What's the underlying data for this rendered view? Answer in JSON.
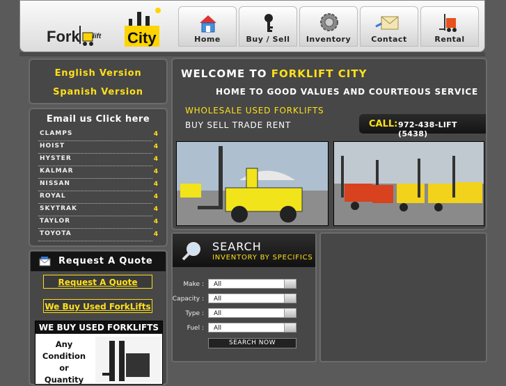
{
  "header": {
    "logo": {
      "word1": "Fork",
      "word2": "lift",
      "word3": "City"
    },
    "nav": [
      {
        "label": "Home",
        "icon": "house-icon"
      },
      {
        "label": "Buy / Sell",
        "icon": "key-icon"
      },
      {
        "label": "Inventory",
        "icon": "gear-icon"
      },
      {
        "label": "Contact",
        "icon": "envelope-icon"
      },
      {
        "label": "Rental",
        "icon": "forklift-icon"
      }
    ]
  },
  "sidebar": {
    "languages": [
      "English Version",
      "Spanish Version"
    ],
    "email": {
      "label": "Email us",
      "link": "Click here"
    },
    "brands": [
      "CLAMPS",
      "HOIST",
      "HYSTER",
      "KALMAR",
      "NISSAN",
      "ROYAL",
      "SKYTRAK",
      "TAYLOR",
      "TOYOTA"
    ],
    "brand_arrow": "4",
    "quote": {
      "title": "Request A Quote",
      "link1": "Request A Quote",
      "link2": "We Buy Used ForkLifts"
    },
    "ad": {
      "banner": "WE BUY USED FORKLIFTS",
      "text": "Any Condition or Quantity"
    }
  },
  "main": {
    "welcome_prefix": "WELCOME TO",
    "welcome_brand": "FORKLIFT CITY",
    "tagline": "HOME TO GOOD VALUES AND COURTEOUS SERVICE",
    "wholesale": "WHOLESALE USED FORKLIFTS",
    "services": "BUY SELL TRADE RENT",
    "call_label": "CALL:",
    "call_number": "972-438-LIFT (5438)"
  },
  "search": {
    "title": "SEARCH",
    "subtitle": "INVENTORY BY SPECIFICS",
    "fields": [
      {
        "label": "Make :",
        "value": "All"
      },
      {
        "label": "Capacity :",
        "value": "All"
      },
      {
        "label": "Type :",
        "value": "All"
      },
      {
        "label": "Fuel :",
        "value": "All"
      }
    ],
    "button": "SEARCH NOW"
  },
  "colors": {
    "accent": "#ffe01a",
    "panel": "#474747",
    "background": "#5a5a5a"
  }
}
